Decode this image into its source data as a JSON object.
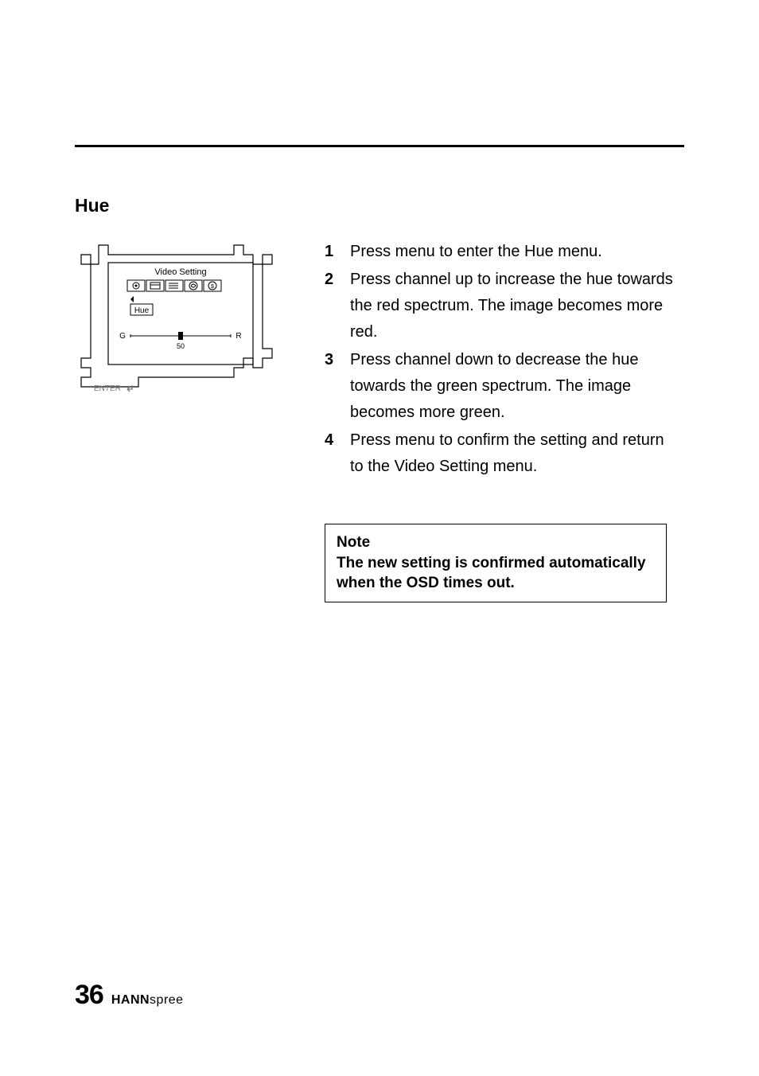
{
  "section_title": "Hue",
  "diagram": {
    "title": "Video Setting",
    "label": "Hue",
    "left_mark": "G",
    "right_mark": "R",
    "value": "50",
    "enter_label": "ENTER"
  },
  "steps": [
    "Press menu to enter the Hue menu.",
    "Press channel up to increase the hue towards the red spectrum. The image becomes more red.",
    "Press channel down to decrease the hue towards the green spectrum. The image becomes more green.",
    "Press menu to confirm the setting and return to the Video Setting menu."
  ],
  "note": {
    "heading": "Note",
    "body": "The new setting is confirmed automatically when the OSD times out."
  },
  "footer": {
    "page_number": "36",
    "brand_bold": "HANN",
    "brand_light": "spree"
  }
}
